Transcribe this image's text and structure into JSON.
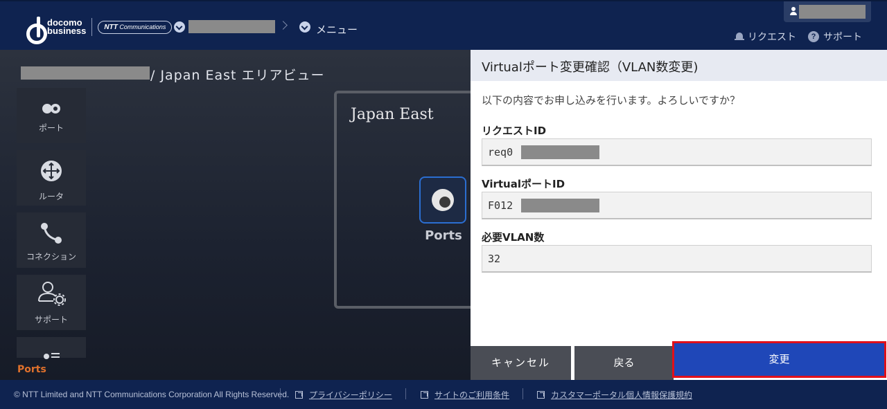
{
  "header": {
    "brand_line1": "docomo",
    "brand_line2": "business",
    "ntt_logo": "NTT",
    "ntt_logo_sub": "Communications",
    "menu_label": "メニュー",
    "request_label": "リクエスト",
    "support_label": "サポート",
    "help_glyph": "?"
  },
  "main": {
    "page_title": "/ Japan East エリアビュー",
    "sidebar": [
      {
        "label": "ポート",
        "icon": "port-icon"
      },
      {
        "label": "ルータ",
        "icon": "router-icon"
      },
      {
        "label": "コネクション",
        "icon": "connection-icon"
      },
      {
        "label": "サポート",
        "icon": "support-user-icon"
      }
    ],
    "region_name": "Japan East",
    "ports_tile_label": "Ports",
    "ports_bottom_label": "Ports"
  },
  "dialog": {
    "title": "Virtualポート変更確認（VLAN数変更)",
    "message": "以下の内容でお申し込みを行います。よろしいですか？",
    "fields": [
      {
        "label": "リクエストID",
        "value": "req0"
      },
      {
        "label": "VirtualポートID",
        "value": "F012"
      },
      {
        "label": "必要VLAN数",
        "value": "32"
      }
    ],
    "buttons": {
      "cancel": "キャンセル",
      "back": "戻る",
      "change": "変更"
    }
  },
  "footer": {
    "copyright": "© NTT Limited and NTT Communications Corporation All Rights Reserved.",
    "links": [
      "プライバシーポリシー",
      "サイトのご利用条件",
      "カスタマーポータル個人情報保護規約"
    ]
  },
  "colors": {
    "header_bg": "#0f2350",
    "accent_blue": "#1f47b8",
    "highlight_red": "#e0101a",
    "ports_orange": "#e0712c"
  }
}
